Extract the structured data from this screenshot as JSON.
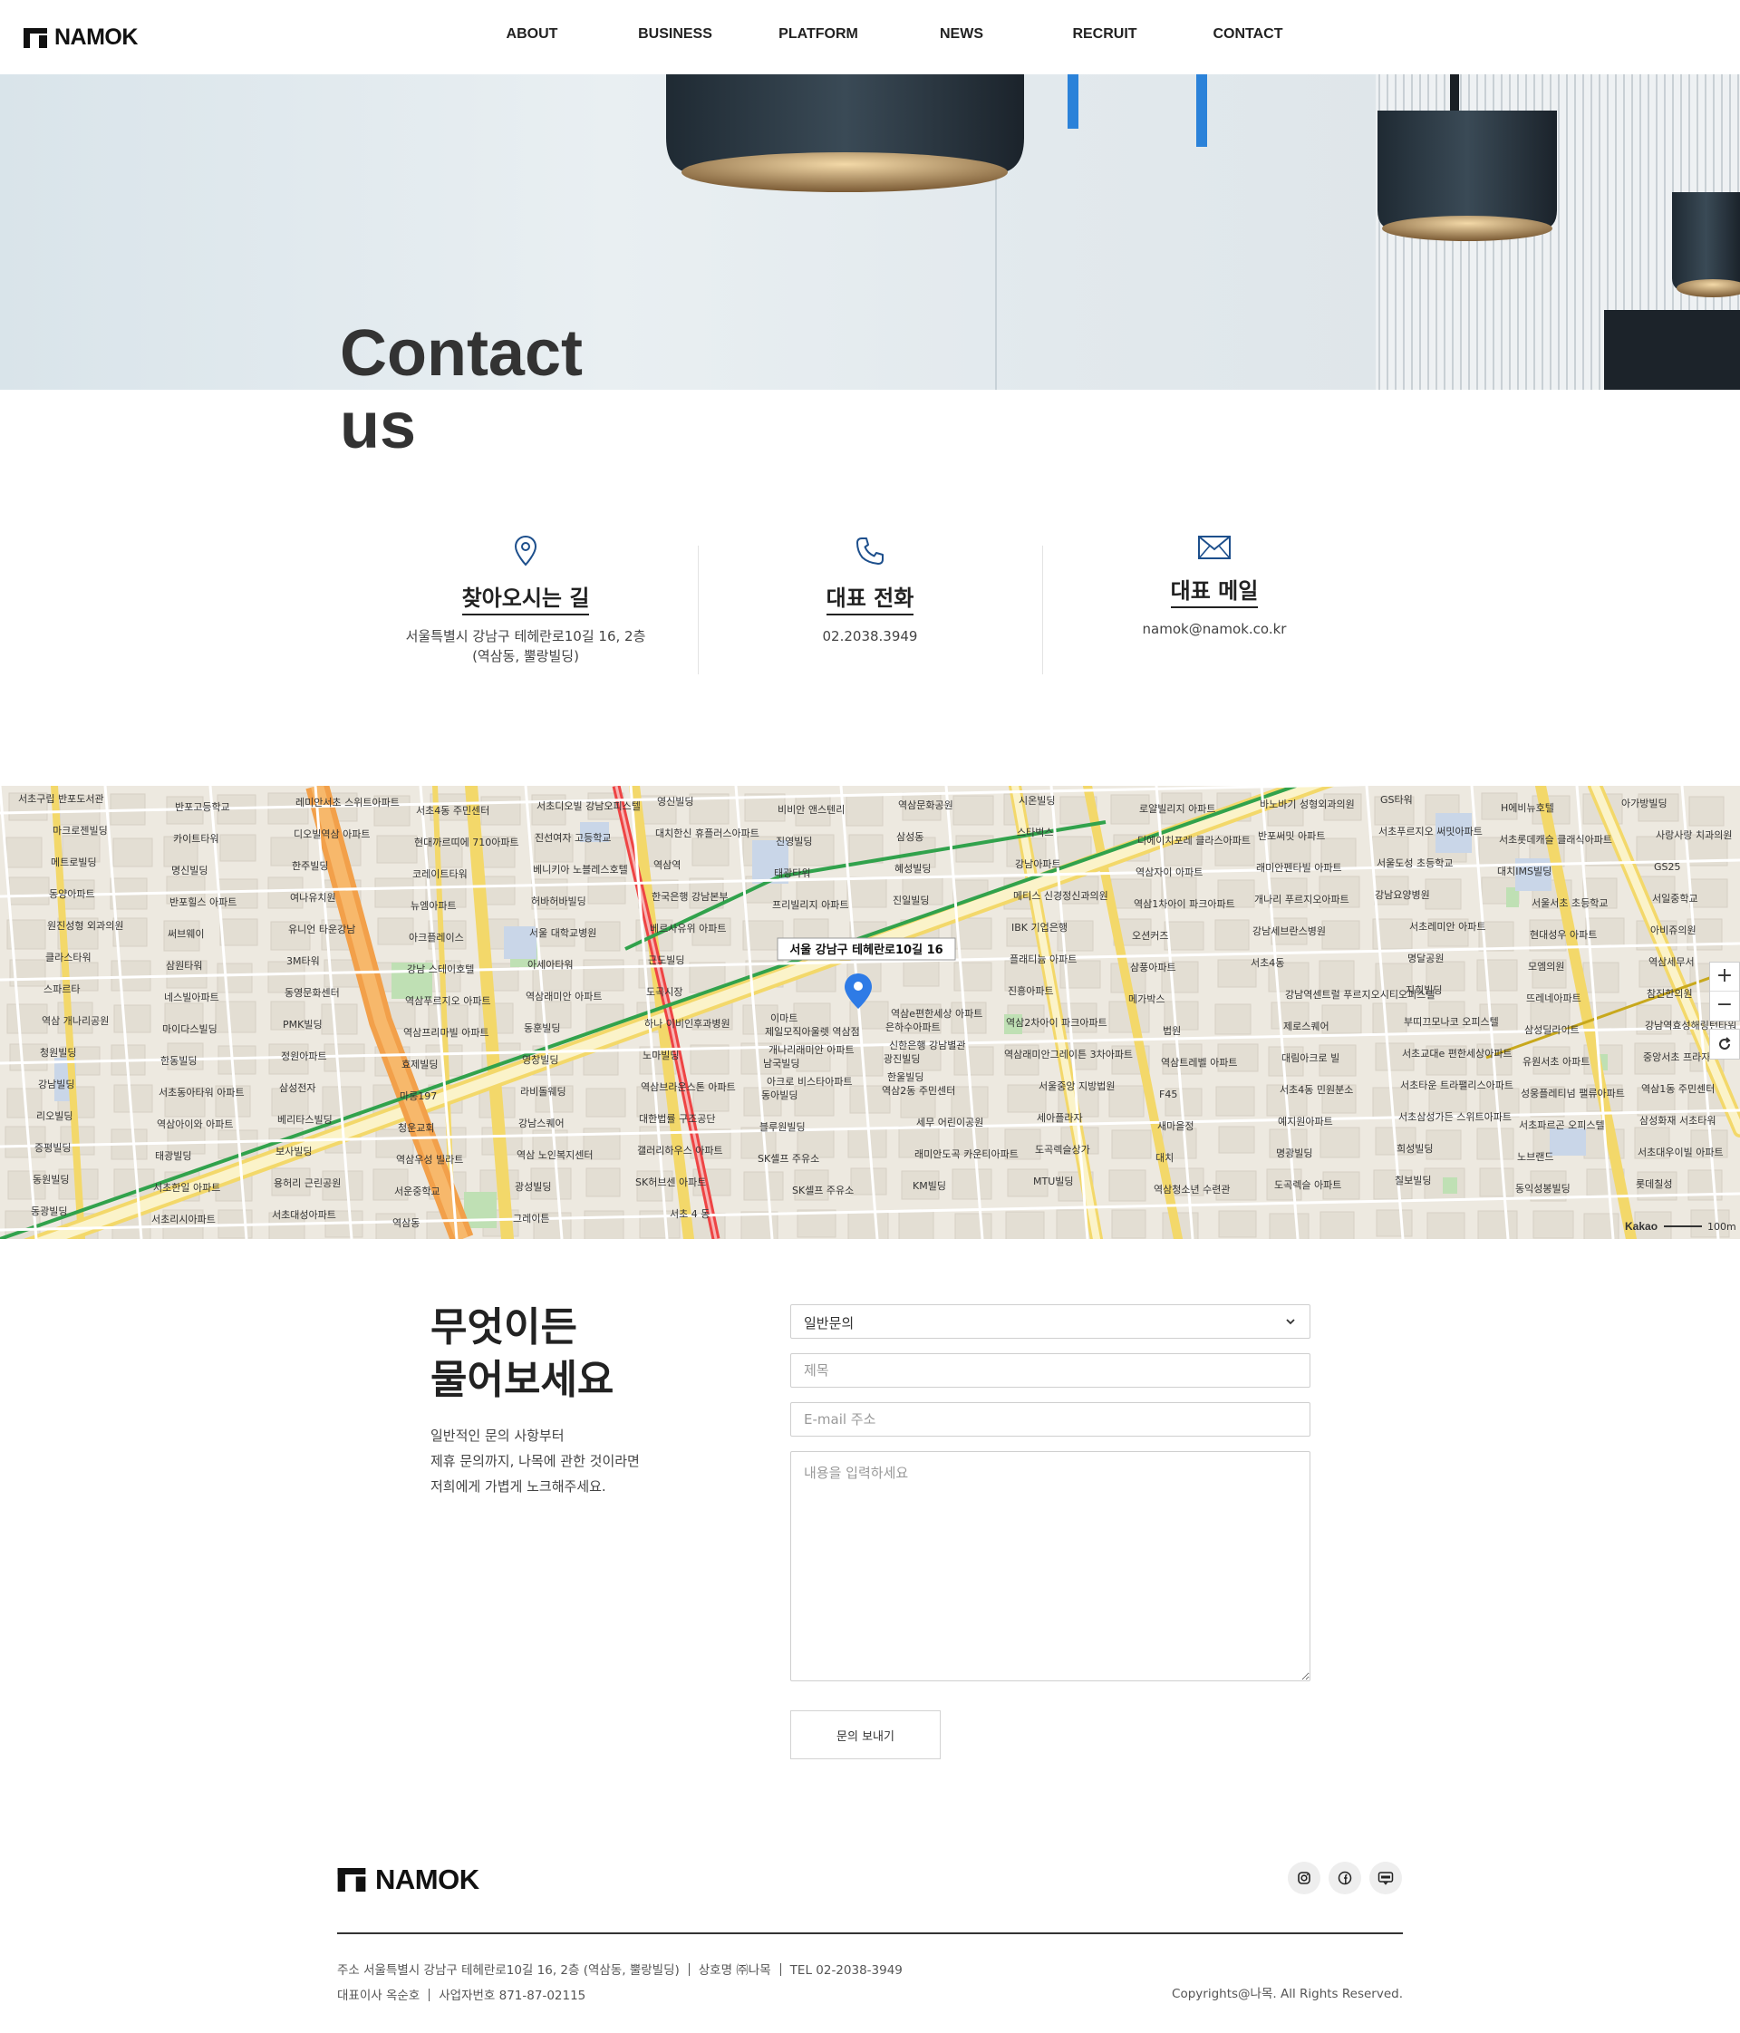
{
  "header": {
    "brand": "NAMOK",
    "nav": [
      "ABOUT",
      "BUSINESS",
      "PLATFORM",
      "NEWS",
      "RECRUIT",
      "CONTACT"
    ]
  },
  "hero": {
    "title_line1": "Contact",
    "title_line2": "us"
  },
  "info": {
    "location": {
      "icon": "map-pin-icon",
      "title": "찾아오시는 길",
      "line1": "서울특별시 강남구 테헤란로10길 16, 2층",
      "line2": "(역삼동, 뿔랑빌딩)"
    },
    "phone": {
      "icon": "phone-icon",
      "title": "대표 전화",
      "value": "02.2038.3949"
    },
    "email": {
      "icon": "mail-icon",
      "title": "대표 메일",
      "value": "namok@namok.co.kr"
    }
  },
  "map": {
    "marker_label": "서울 강남구 테헤란로10길 16",
    "scale_label": "100m",
    "provider": "Kakao",
    "labels": [
      "서초구립 반포도서관",
      "반포고등학교",
      "레미안서초 스위트아파트",
      "서초4동 주민센터",
      "서초디오빌 강남오피스텔",
      "영신빌딩",
      "비비안 앤스텐리",
      "역삼문화공원",
      "시온빌딩",
      "로얄빌리지 아파트",
      "바노바기 성형외과의원",
      "GS타워",
      "H에비뉴호텔",
      "아가방빌딩",
      "마크로젠빌딩",
      "카이트타워",
      "디오빌역삼 아파트",
      "현대까르띠에 710아파트",
      "진선여자 고등학교",
      "대치한신 휴플러스아파트",
      "진영빌딩",
      "삼성동",
      "스타벅스",
      "디에이치포레 클라스아파트",
      "반포써밋 아파트",
      "서초푸르지오 써밋아파트",
      "서초롯데캐슬 클래식아파트",
      "사랑사랑 치과의원",
      "메트로빌딩",
      "명신빌딩",
      "한주빌딩",
      "코레이트타워",
      "베니키아 노블레스호텔",
      "역삼역",
      "태광타워",
      "혜성빌딩",
      "강남아파트",
      "역삼자이 아파트",
      "래미안펜타빌 아파트",
      "서울도성 초등학교",
      "대치IMS빌딩",
      "GS25",
      "동양아파트",
      "반포힐스 아파트",
      "여나유치원",
      "뉴엠아파트",
      "허바허바빌딩",
      "한국은행 강남본부",
      "프리빌리지 아파트",
      "진일빌딩",
      "메티스 신경정신과의원",
      "역삼1차아이 파크아파트",
      "개나리 푸르지오아파트",
      "강남요양병원",
      "서울서초 초등학교",
      "서일중학교",
      "원진성형 외과의원",
      "써브웨이",
      "유니언 타운강남",
      "아크플레이스",
      "서울 대학교병원",
      "베르사유위 아파트",
      "이마트",
      "역삼e편한세상 아파트",
      "IBK 기업은행",
      "오션커즈",
      "강남세브란스병원",
      "서초레미안 아파트",
      "현대성우 아파트",
      "아비쥬의원",
      "클라스타워",
      "삼원타워",
      "3M타워",
      "강남 스테이호텔",
      "아세아타워",
      "근도빌딩",
      "개나리래미안 아파트",
      "신한은행 강남별관",
      "플래티늄 아파트",
      "삼풍아파트",
      "서초4동",
      "명달공원",
      "모엠의원",
      "역삼세무서",
      "스파르타",
      "네스빌아파트",
      "동영문화센터",
      "역삼푸르지오 아파트",
      "역삼래미안 아파트",
      "도곡시장",
      "아크로 비스타아파트",
      "한울빌딩",
      "진흥아파트",
      "메가박스",
      "강남역센트럴 푸르지오시티오피스텔",
      "지희빌딩",
      "뜨레네아파트",
      "참진한의원",
      "역삼 개나리공원",
      "마이다스빌딩",
      "PMK빌딩",
      "역삼프리마빌 아파트",
      "동훈빌딩",
      "하나 이비인후과병원",
      "제일모직아울렛 역삼점",
      "은하수아파트",
      "역삼2차아이 파크아파트",
      "법원",
      "제로스퀘어",
      "부띠끄모나코 오피스텔",
      "삼성딜라이트",
      "강남역효성해링턴타워 더퍼스트오피스텔",
      "청원빌딩",
      "한동빌딩",
      "정원아파트",
      "효제빌딩",
      "영창빌딩",
      "노마빌딩",
      "남국빌딩",
      "광진빌딩",
      "역삼래미안그레이튼 3차아파트",
      "역삼트레벨 아파트",
      "대림아크로 빌",
      "서초교대e 편한세상아파트",
      "유원서초 아파트",
      "중앙서초 프라자",
      "강남빌딩",
      "서초동아타워 아파트",
      "삼성전자",
      "마롱197",
      "라비돌웨딩",
      "역삼브라운스톤 아파트",
      "동아빌딩",
      "역삼2동 주민센터",
      "서울중앙 지방법원",
      "F45",
      "서초4동 민원분소",
      "서초타운 트라팰리스아파트",
      "성웅플레티넘 팰류아파트",
      "역삼1동 주민센터",
      "리오빌딩",
      "역삼아이와 아파트",
      "베리타스빌딩",
      "청운교회",
      "강남스퀘어",
      "대한법률 구조공단",
      "블루원빌딩",
      "세무 어린이공원",
      "세아플라자",
      "새마을정",
      "예지원아파트",
      "서초삼성가든 스위트아파트",
      "서초파르곤 오피스텔",
      "삼성화재 서초타워",
      "증평빌딩",
      "태광빌딩",
      "보사빌딩",
      "역삼우성 빌라트",
      "역삼 노인복지센터",
      "갤러리하우스 아파트",
      "SK셀프 주유소",
      "래미안도곡 카운티아파트",
      "도곡렉슬상가",
      "대치",
      "명광빌딩",
      "희성빌딩",
      "노브랜드",
      "서초대우이빌 아파트",
      "동원빌딩",
      "서초한일 아파트",
      "용허리 근린공원",
      "서운중학교",
      "광성빌딩",
      "SK허브센 아파트",
      "SK셀프 주유소",
      "KM빌딩",
      "MTU빌딩",
      "역삼청소년 수련관",
      "도곡렉슬 아파트",
      "칠보빌딩",
      "동익성봉빌딩",
      "롯데칠성",
      "동광빌딩",
      "서초리시아파트",
      "서초대성아파트",
      "역삼동",
      "그레이튼",
      "서초 4 동"
    ]
  },
  "inquiry": {
    "title_line1": "무엇이든",
    "title_line2": "물어보세요",
    "desc": [
      "일반적인 문의 사항부터",
      "제휴 문의까지, 나목에 관한 것이라면",
      "저희에게 가볍게 노크해주세요."
    ],
    "select_value": "일반문의",
    "subject_placeholder": "제목",
    "email_placeholder": "E-mail 주소",
    "content_placeholder": "내용을 입력하세요",
    "submit_label": "문의 보내기"
  },
  "footer": {
    "brand": "NAMOK",
    "socials": [
      "instagram-icon",
      "facebook-icon",
      "blog-icon"
    ],
    "address": "주소 서울특별시 강남구 테헤란로10길 16, 2층 (역삼동, 뿔랑빌딩)",
    "company": "상호명 ㈜나목",
    "tel": "TEL 02-2038-3949",
    "ceo": "대표이사 옥순호",
    "biz_no": "사업자번호 871-87-02115",
    "copyright": "Copyrights@나목. All Rights Reserved."
  },
  "colors": {
    "accent_blue": "#1d4f8c",
    "map_road_yellow": "#f7e27a",
    "map_road_orange": "#f5a04a",
    "map_subway_green": "#31a24c",
    "map_subway_red": "#d93a3a",
    "marker_blue": "#2e7be6"
  }
}
